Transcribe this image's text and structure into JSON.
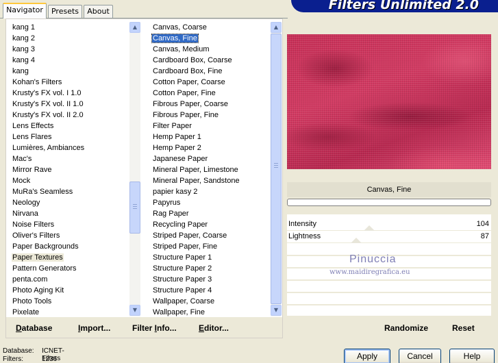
{
  "tabs": [
    "Navigator",
    "Presets",
    "About"
  ],
  "banner": "Filters Unlimited 2.0",
  "categories": [
    "kang 1",
    "kang 2",
    "kang 3",
    "kang 4",
    "kang",
    "Kohan's Filters",
    "Krusty's FX vol. I 1.0",
    "Krusty's FX vol. II 1.0",
    "Krusty's FX vol. II 2.0",
    "Lens Effects",
    "Lens Flares",
    "Lumières, Ambiances",
    "Mac's",
    "Mirror Rave",
    "Mock",
    "MuRa's Seamless",
    "Neology",
    "Nirvana",
    "Noise Filters",
    "Oliver's Filters",
    "Paper Backgrounds",
    "Paper Textures",
    "Pattern Generators",
    "penta.com",
    "Photo Aging Kit",
    "Photo Tools",
    "Pixelate"
  ],
  "filters": [
    "Canvas, Coarse",
    "Canvas, Fine",
    "Canvas, Medium",
    "Cardboard Box, Coarse",
    "Cardboard Box, Fine",
    "Cotton Paper, Coarse",
    "Cotton Paper, Fine",
    "Fibrous Paper, Coarse",
    "Fibrous Paper, Fine",
    "Filter Paper",
    "Hemp Paper 1",
    "Hemp Paper 2",
    "Japanese Paper",
    "Mineral Paper, Limestone",
    "Mineral Paper, Sandstone",
    "papier kasy 2",
    "Papyrus",
    "Rag Paper",
    "Recycling Paper",
    "Striped Paper, Coarse",
    "Striped Paper, Fine",
    "Structure Paper 1",
    "Structure Paper 2",
    "Structure Paper 3",
    "Structure Paper 4",
    "Wallpaper, Coarse",
    "Wallpaper, Fine"
  ],
  "selected_category_index": 21,
  "selected_filter_index": 1,
  "bottom_buttons": {
    "database_first": "D",
    "database_rest": "atabase",
    "import_first": "I",
    "import_rest": "mport...",
    "filterinfo_a": "Filter ",
    "filterinfo_u": "I",
    "filterinfo_b": "nfo...",
    "editor_first": "E",
    "editor_rest": "ditor..."
  },
  "filter_name": "Canvas, Fine",
  "params": [
    {
      "name": "Intensity",
      "value": "104"
    },
    {
      "name": "Lightness",
      "value": "87"
    }
  ],
  "randomize": "Randomize",
  "reset": "Reset",
  "watermark": {
    "line1": "Pinuccia",
    "line2": "www.maidiregrafica.eu"
  },
  "status": {
    "database_label": "Database:",
    "database_value": "ICNET-Filters",
    "filters_label": "Filters:",
    "filters_value": "1236"
  },
  "buttons": {
    "apply": "Apply",
    "cancel": "Cancel",
    "help": "Help"
  }
}
